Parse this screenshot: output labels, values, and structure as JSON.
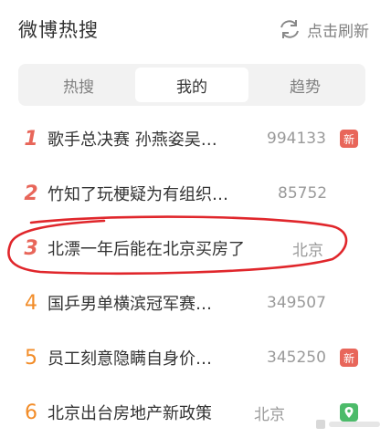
{
  "header": {
    "title": "微博热搜",
    "refresh_label": "点击刷新"
  },
  "tabs": [
    {
      "label": "热搜",
      "active": false
    },
    {
      "label": "我的",
      "active": true
    },
    {
      "label": "趋势",
      "active": false
    }
  ],
  "items": [
    {
      "rank": "1",
      "topic": "歌手总决赛 孙燕姿吴…",
      "meta": "994133",
      "badge": "新",
      "badge_type": "new"
    },
    {
      "rank": "2",
      "topic": "竹知了玩梗疑为有组织…",
      "meta": "85752",
      "badge": "",
      "badge_type": ""
    },
    {
      "rank": "3",
      "topic": "北漂一年后能在北京买房了",
      "meta": "北京",
      "badge": "",
      "badge_type": ""
    },
    {
      "rank": "4",
      "topic": "国乒男单横滨冠军赛…",
      "meta": "349507",
      "badge": "",
      "badge_type": ""
    },
    {
      "rank": "5",
      "topic": "员工刻意隐瞒自身价…",
      "meta": "345250",
      "badge": "新",
      "badge_type": "new"
    },
    {
      "rank": "6",
      "topic": "北京出台房地产新政策",
      "meta": "北京",
      "badge": "",
      "badge_type": "location"
    }
  ],
  "colors": {
    "rank_top": "#e8665a",
    "rank_rest": "#f28c28",
    "annotation_circle": "#e0262b",
    "new_badge": "#e8665a",
    "location_badge": "#4cbb6a"
  }
}
